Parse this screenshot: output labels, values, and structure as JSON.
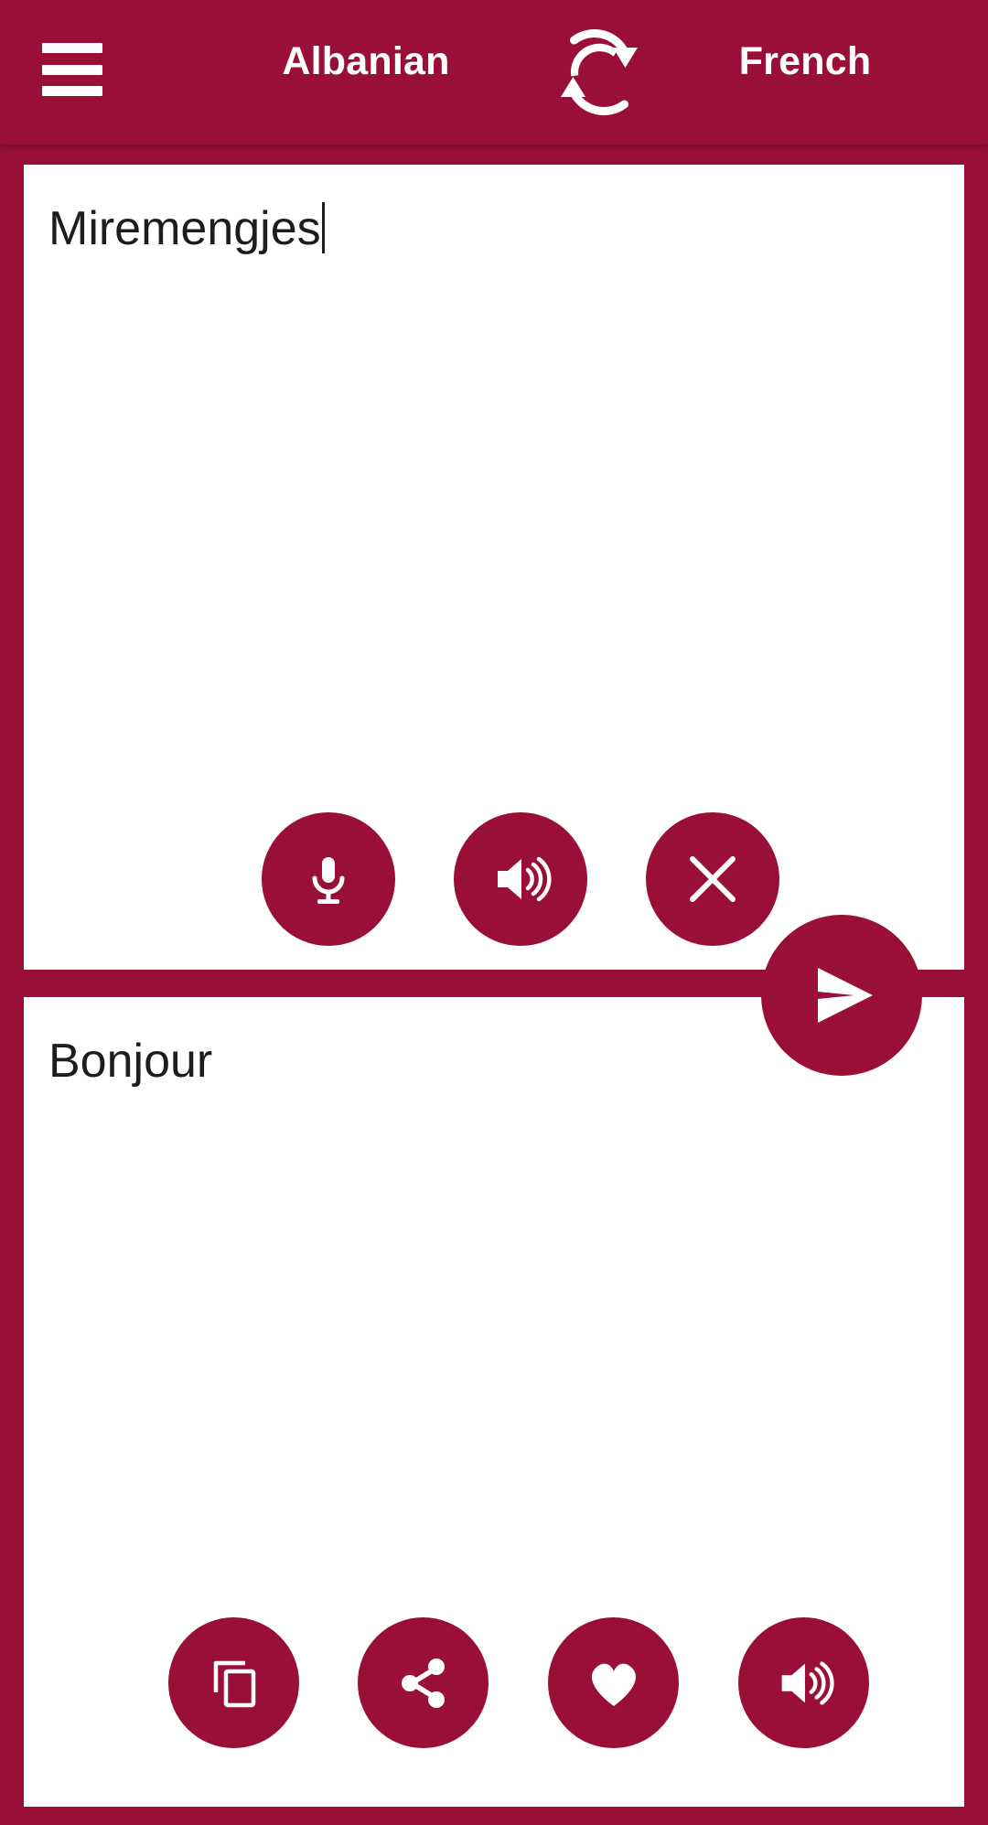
{
  "app": {
    "brand_color": "#9a0f38",
    "panel_color": "#ffffff",
    "text_color": "#1d1d1d"
  },
  "header": {
    "menu_label": "menu",
    "source_language": "Albanian",
    "target_language": "French",
    "swap_label": "swap languages"
  },
  "source_panel": {
    "text": "Miremengjes",
    "has_caret": true,
    "actions": [
      {
        "name": "microphone",
        "label": "voice input"
      },
      {
        "name": "speaker",
        "label": "listen"
      },
      {
        "name": "close",
        "label": "clear text"
      }
    ]
  },
  "send_button": {
    "name": "send",
    "label": "translate"
  },
  "target_panel": {
    "text": "Bonjour",
    "actions": [
      {
        "name": "copy",
        "label": "copy"
      },
      {
        "name": "share",
        "label": "share"
      },
      {
        "name": "heart",
        "label": "favorite"
      },
      {
        "name": "speaker",
        "label": "listen"
      }
    ]
  }
}
